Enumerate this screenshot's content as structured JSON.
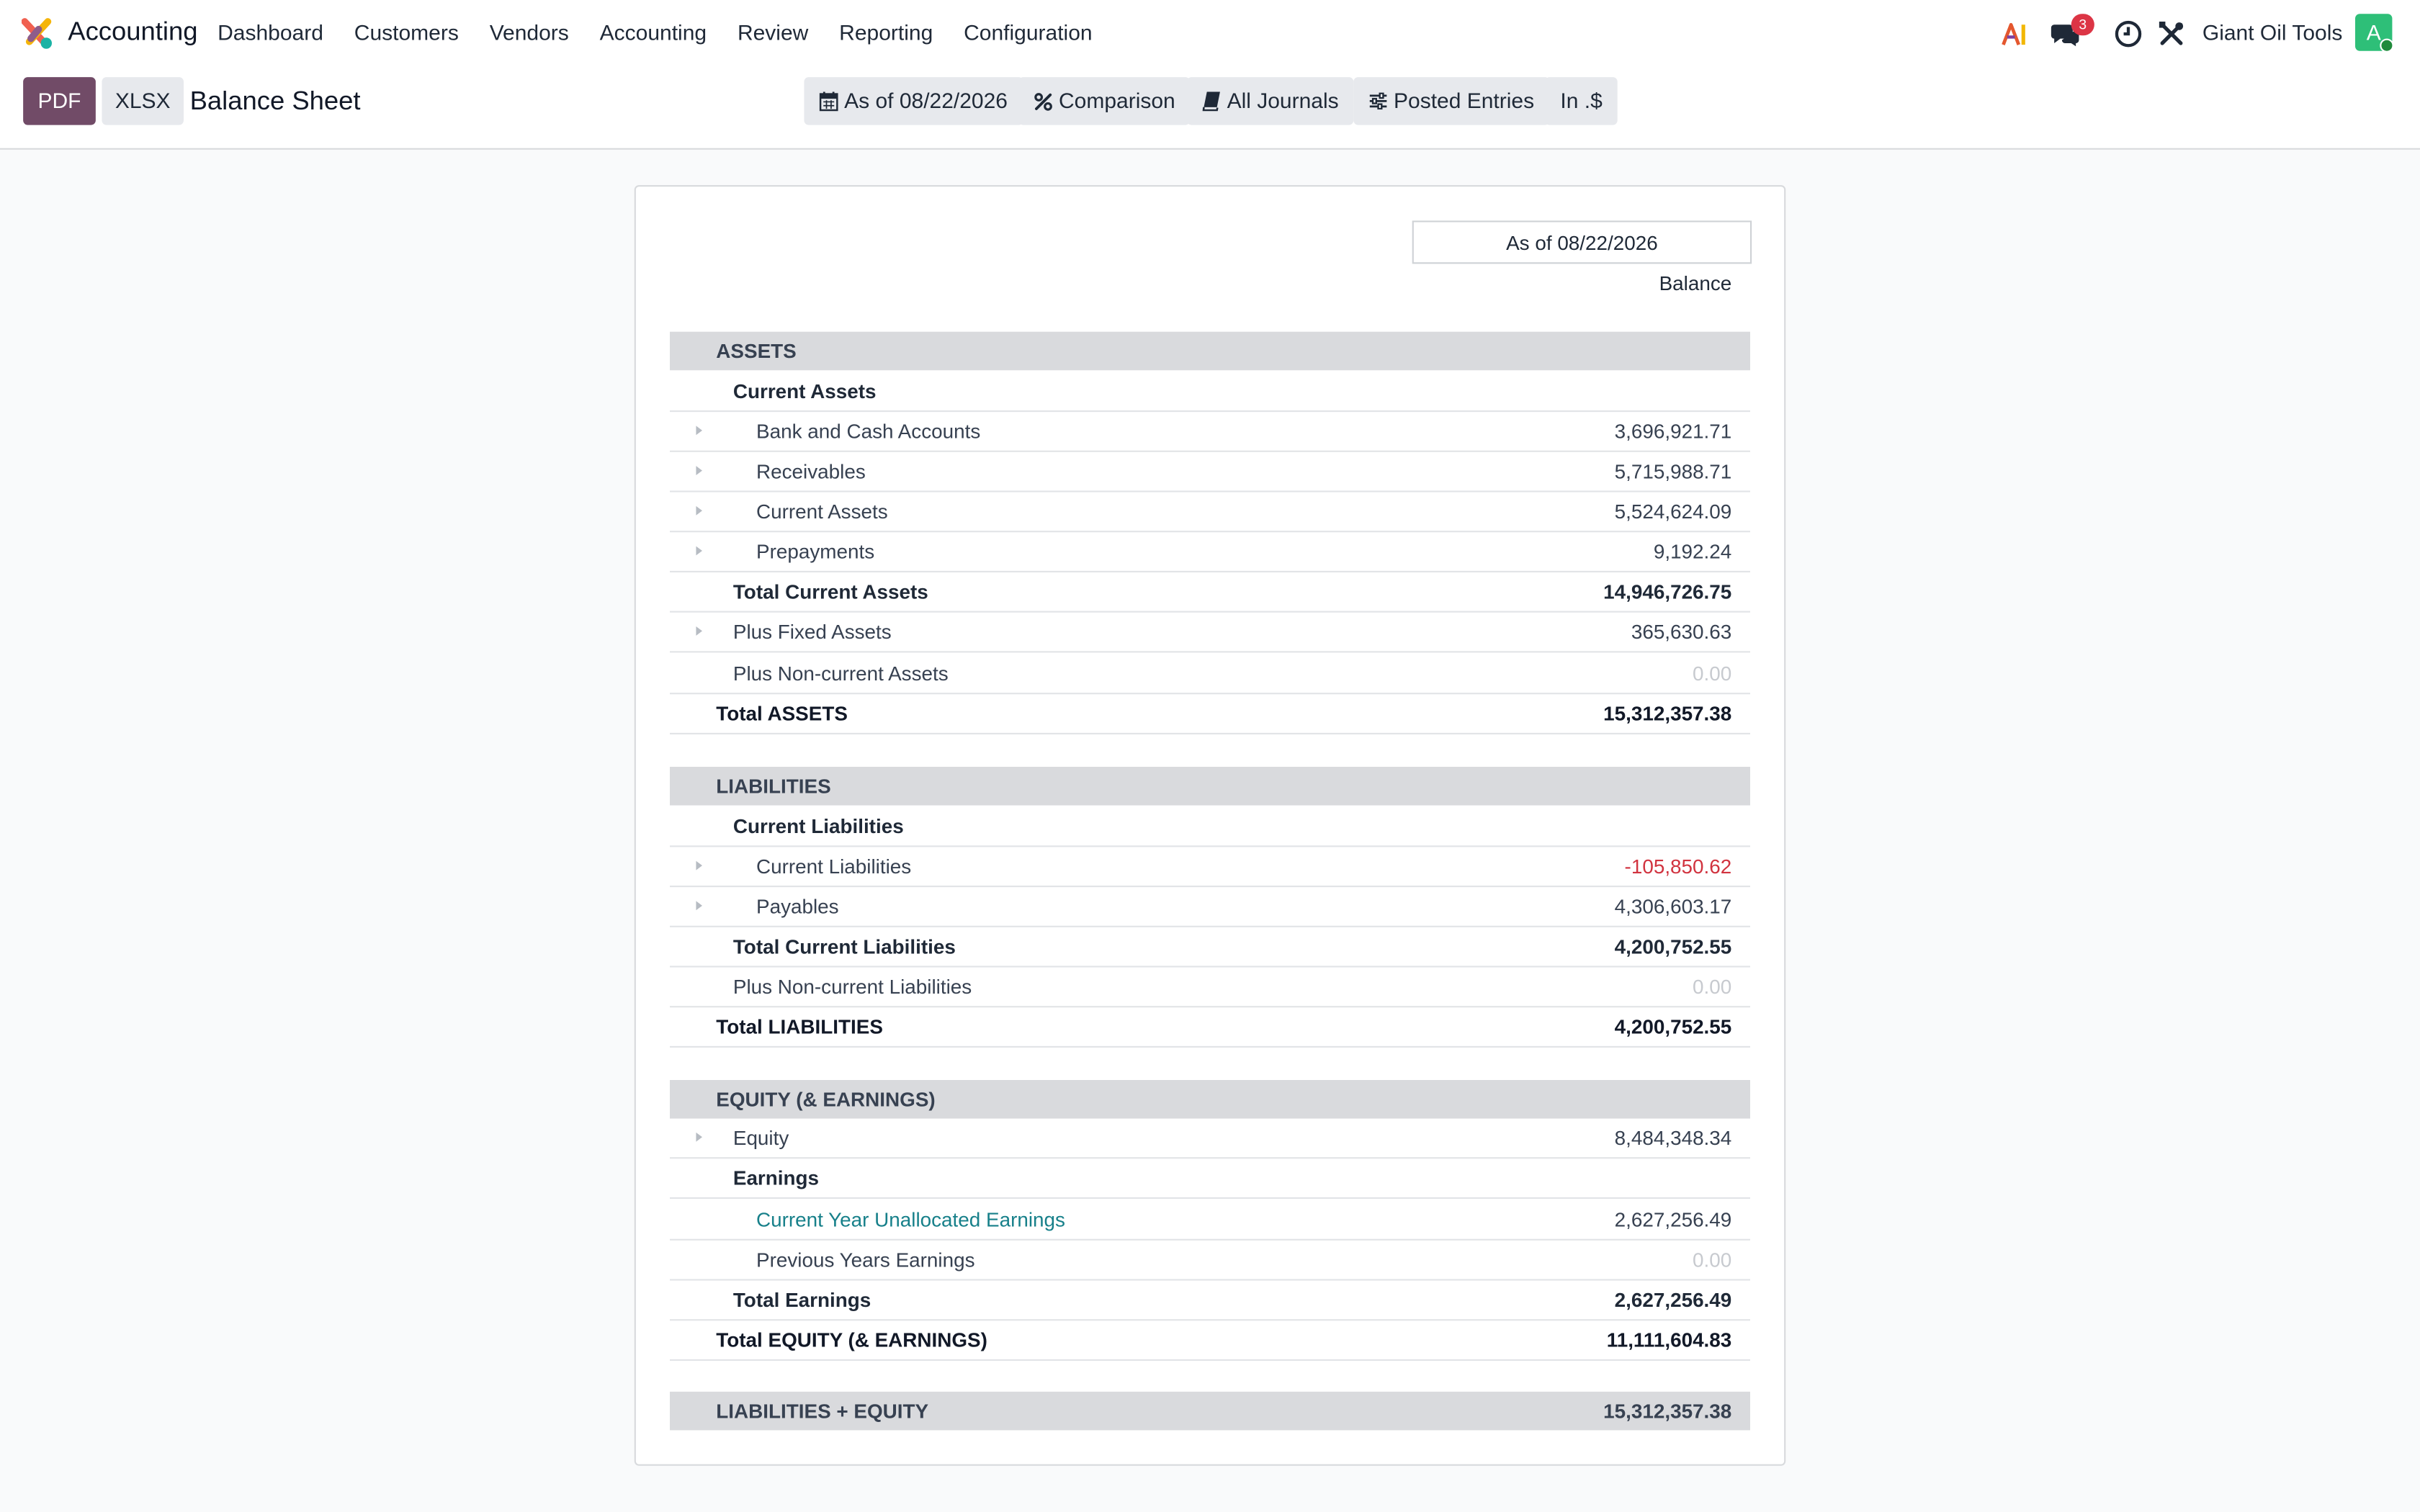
{
  "navbar": {
    "app_name": "Accounting",
    "menu": [
      "Dashboard",
      "Customers",
      "Vendors",
      "Accounting",
      "Review",
      "Reporting",
      "Configuration"
    ],
    "messages_badge": "3",
    "company": "Giant Oil Tools",
    "avatar_letter": "A",
    "icons": [
      "ai-icon",
      "chat-icon",
      "clock-icon",
      "tools-icon"
    ]
  },
  "control": {
    "pdf_label": "PDF",
    "xlsx_label": "XLSX",
    "title": "Balance Sheet",
    "filters": {
      "date": "As of 08/22/2026",
      "comparison": "Comparison",
      "journals": "All Journals",
      "entries": "Posted Entries",
      "currency": "In .$"
    }
  },
  "report": {
    "period_header": "As of 08/22/2026",
    "column_header": "Balance",
    "rows": [
      {
        "label": "ASSETS",
        "amount": "",
        "kind": "section",
        "level": 1
      },
      {
        "label": "Current Assets",
        "amount": "",
        "kind": "bold",
        "level": 2
      },
      {
        "label": "Bank and Cash Accounts",
        "amount": "3,696,921.71",
        "kind": "line",
        "level": 3,
        "caret": true
      },
      {
        "label": "Receivables",
        "amount": "5,715,988.71",
        "kind": "line",
        "level": 3,
        "caret": true
      },
      {
        "label": "Current Assets",
        "amount": "5,524,624.09",
        "kind": "line",
        "level": 3,
        "caret": true
      },
      {
        "label": "Prepayments",
        "amount": "9,192.24",
        "kind": "line",
        "level": 3,
        "caret": true
      },
      {
        "label": "Total Current Assets",
        "amount": "14,946,726.75",
        "kind": "bold",
        "level": 2
      },
      {
        "label": "Plus Fixed Assets",
        "amount": "365,630.63",
        "kind": "line",
        "level": 2,
        "caret": true
      },
      {
        "label": "Plus Non-current Assets",
        "amount": "0.00",
        "kind": "line",
        "level": 2,
        "zero": true
      },
      {
        "label": "Total ASSETS",
        "amount": "15,312,357.38",
        "kind": "total",
        "level": 1
      },
      {
        "label": "LIABILITIES",
        "amount": "",
        "kind": "section",
        "level": 1
      },
      {
        "label": "Current Liabilities",
        "amount": "",
        "kind": "bold",
        "level": 2
      },
      {
        "label": "Current Liabilities",
        "amount": "-105,850.62",
        "kind": "line",
        "level": 3,
        "caret": true,
        "negative": true
      },
      {
        "label": "Payables",
        "amount": "4,306,603.17",
        "kind": "line",
        "level": 3,
        "caret": true
      },
      {
        "label": "Total Current Liabilities",
        "amount": "4,200,752.55",
        "kind": "bold",
        "level": 2
      },
      {
        "label": "Plus Non-current Liabilities",
        "amount": "0.00",
        "kind": "line",
        "level": 2,
        "zero": true
      },
      {
        "label": "Total LIABILITIES",
        "amount": "4,200,752.55",
        "kind": "total",
        "level": 1
      },
      {
        "label": "EQUITY (& EARNINGS)",
        "amount": "",
        "kind": "section",
        "level": 1
      },
      {
        "label": "Equity",
        "amount": "8,484,348.34",
        "kind": "line",
        "level": 2,
        "caret": true
      },
      {
        "label": "Earnings",
        "amount": "",
        "kind": "bold",
        "level": 2
      },
      {
        "label": "Current Year Unallocated Earnings",
        "amount": "2,627,256.49",
        "kind": "line",
        "level": 3,
        "link": true
      },
      {
        "label": "Previous Years Earnings",
        "amount": "0.00",
        "kind": "line",
        "level": 3,
        "zero": true
      },
      {
        "label": "Total Earnings",
        "amount": "2,627,256.49",
        "kind": "bold",
        "level": 2
      },
      {
        "label": "Total EQUITY (& EARNINGS)",
        "amount": "11,111,604.83",
        "kind": "total",
        "level": 1
      },
      {
        "label": "LIABILITIES + EQUITY",
        "amount": "15,312,357.38",
        "kind": "section",
        "level": 1
      }
    ]
  },
  "colors": {
    "brand": "#714b67",
    "negative": "#d1333f",
    "link": "#17808a",
    "section_bg": "#d9dadd"
  }
}
